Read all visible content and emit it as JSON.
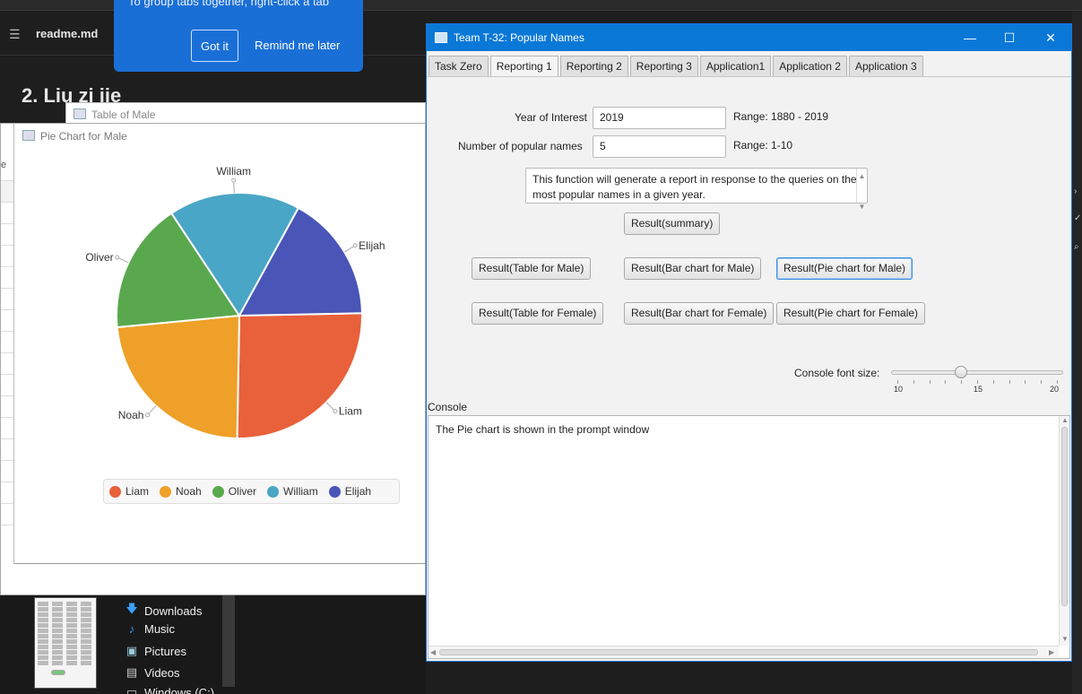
{
  "background": {
    "file_name": "readme.md",
    "heading": "2. Liu zi jie",
    "folders": [
      {
        "label": "Downloads",
        "icon": "download-arrow-icon"
      },
      {
        "label": "Music",
        "icon": "music-note-icon"
      },
      {
        "label": "Pictures",
        "icon": "pictures-icon"
      },
      {
        "label": "Videos",
        "icon": "videos-icon"
      },
      {
        "label": "Windows (C:)",
        "icon": "drive-icon"
      }
    ]
  },
  "popup": {
    "text": "To group tabs together, right-click a tab",
    "got_it": "Got it",
    "remind": "Remind me later"
  },
  "table_window": {
    "title": "Table of Male"
  },
  "pie_window": {
    "title": "Pie Chart for Male",
    "strip_label": "e"
  },
  "chart_data": {
    "type": "pie",
    "title": "",
    "categories": [
      "Liam",
      "Noah",
      "Oliver",
      "William",
      "Elijah"
    ],
    "values": [
      25.6,
      23.2,
      17.2,
      17.3,
      16.7
    ],
    "colors": [
      "#e8613a",
      "#efa029",
      "#5aa84e",
      "#4aa6c6",
      "#4a55b8"
    ],
    "legend_position": "bottom"
  },
  "app": {
    "title": "Team T-32: Popular Names",
    "window_buttons": {
      "minimize": "—",
      "maximize": "☐",
      "close": "✕"
    },
    "tabs": [
      "Task Zero",
      "Reporting 1",
      "Reporting 2",
      "Reporting 3",
      "Application1",
      "Application 2",
      "Application 3"
    ],
    "active_tab": "Reporting 1",
    "year_label": "Year of Interest",
    "year_value": "2019",
    "year_range": "Range: 1880 - 2019",
    "num_label": "Number of popular names",
    "num_value": "5",
    "num_range": "Range: 1-10",
    "description": "This function will generate a report in response to the queries on the most popular names in a given year.",
    "buttons": {
      "summary": "Result(summary)",
      "table_male": "Result(Table for Male)",
      "bar_male": "Result(Bar chart for Male)",
      "pie_male": "Result(Pie chart for Male)",
      "table_female": "Result(Table for Female)",
      "bar_female": "Result(Bar chart for Female)",
      "pie_female": "Result(Pie chart for Female)"
    },
    "font_size_label": "Console font size:",
    "slider": {
      "min": 10,
      "max": 20,
      "value": 14,
      "tick_labels": [
        "10",
        "15",
        "20"
      ]
    },
    "console_label": "Console",
    "console_text": "The Pie chart is shown in the prompt window"
  }
}
